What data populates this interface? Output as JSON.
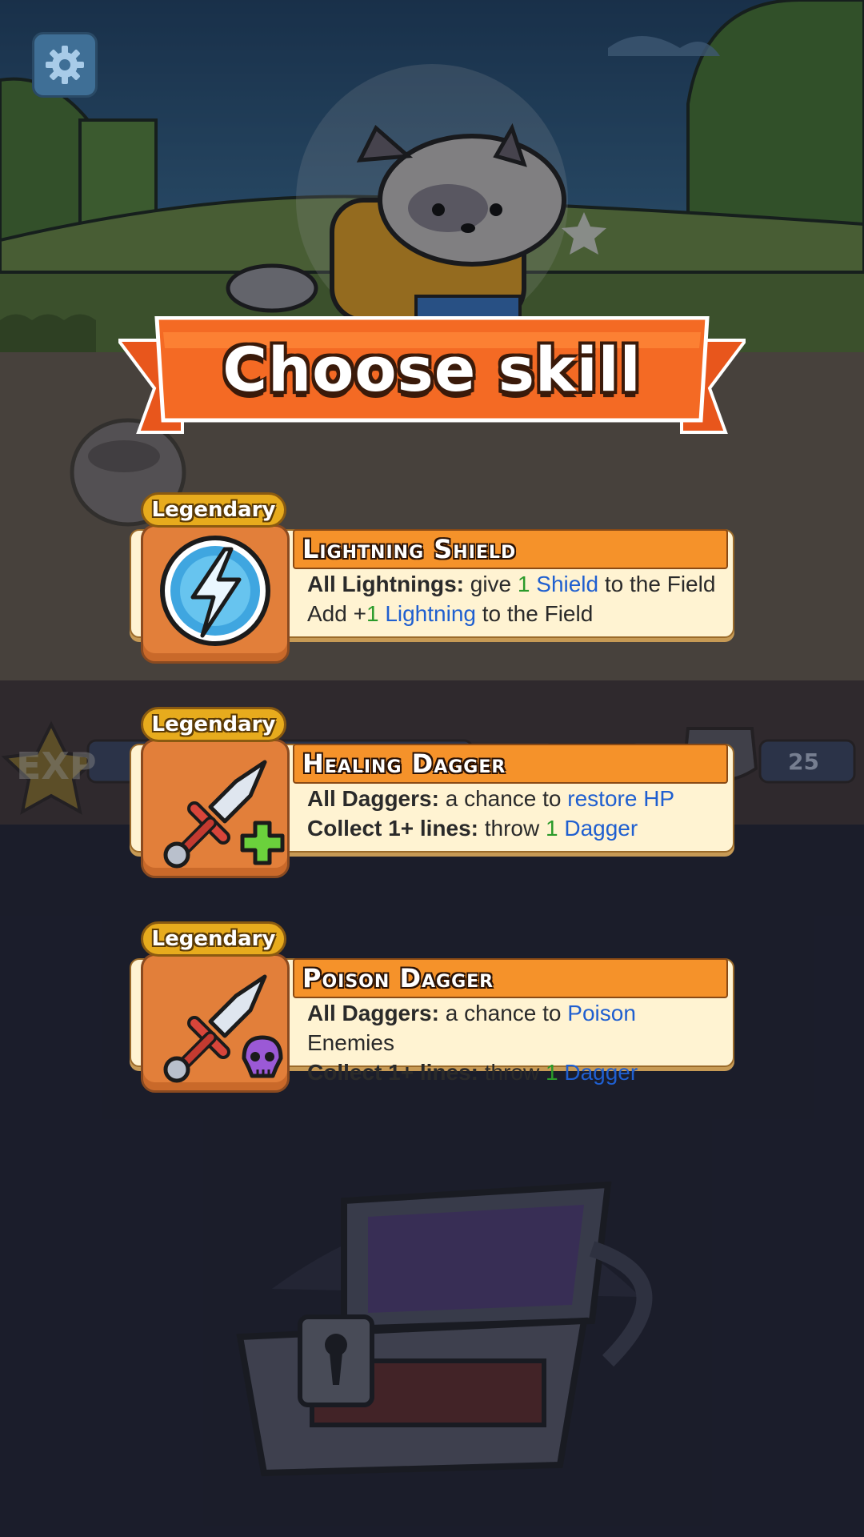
{
  "screen": {
    "title": "Choose skill",
    "settings_icon": "gear-icon"
  },
  "colors": {
    "banner": "#f46a24",
    "card_bg": "#fff3d2",
    "header_bar": "#f5922a",
    "icon_box": "#e27f3a",
    "rarity_badge": "#e7ab1d",
    "green_number": "#2a9a2a",
    "blue_keyword": "#1f5fd0"
  },
  "background": {
    "hud_left_label": "EXP",
    "hud_right_value": "25"
  },
  "skills": [
    {
      "rarity": "Legendary",
      "name": "Lightning Shield",
      "icon": "lightning-orb-icon",
      "desc": {
        "l1_bold": "All Lightnings:",
        "l1_text": "give",
        "l1_num": "1",
        "l1_keyword": "Shield",
        "l1_tail": "to the Field",
        "l2_text": "Add +",
        "l2_num": "1",
        "l2_keyword": "Lightning",
        "l2_tail": "to the Field"
      }
    },
    {
      "rarity": "Legendary",
      "name": "Healing Dagger",
      "icon": "healing-dagger-icon",
      "desc": {
        "l1_bold": "All Daggers:",
        "l1_text": "a chance to",
        "l1_keyword": "restore HP",
        "l2_bold": "Collect 1+ lines:",
        "l2_text": "throw",
        "l2_num": "1",
        "l2_keyword": "Dagger"
      }
    },
    {
      "rarity": "Legendary",
      "name": "Poison Dagger",
      "icon": "poison-dagger-icon",
      "desc": {
        "l1_bold": "All Daggers:",
        "l1_text": "a chance to",
        "l1_keyword": "Poison",
        "l1_tail": "Enemies",
        "l2_bold": "Collect 1+ lines:",
        "l2_text": "throw",
        "l2_num": "1",
        "l2_keyword": "Dagger"
      }
    }
  ]
}
